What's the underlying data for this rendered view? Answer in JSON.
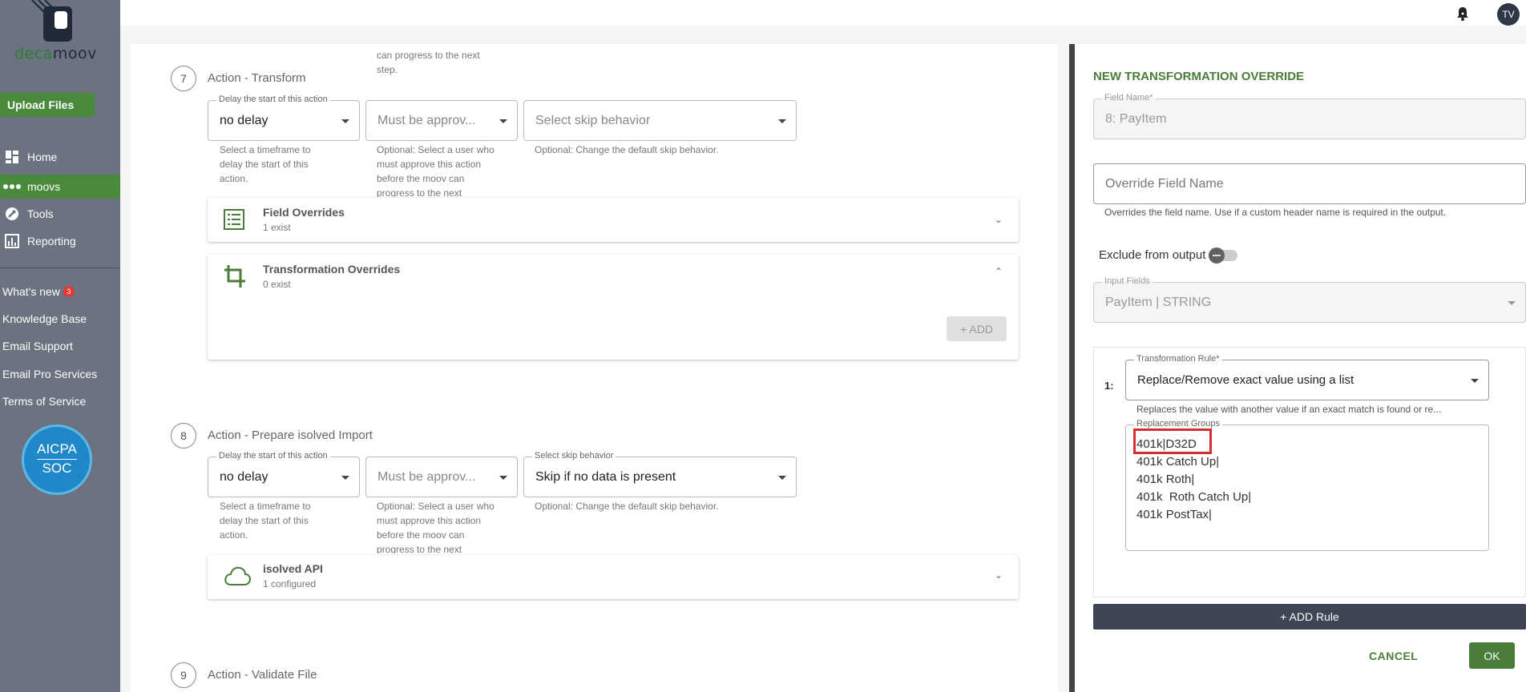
{
  "sidebar": {
    "logo_part1": "deca",
    "logo_part2": "moov",
    "upload_label": "Upload Files",
    "nav": [
      {
        "label": "Home",
        "icon": "home-grid-icon"
      },
      {
        "label": "moovs",
        "icon": "dots-icon",
        "active": true
      },
      {
        "label": "Tools",
        "icon": "wrench-icon"
      },
      {
        "label": "Reporting",
        "icon": "bar-chart-icon"
      }
    ],
    "links": [
      {
        "label": "What's new",
        "badge": "3"
      },
      {
        "label": "Knowledge Base"
      },
      {
        "label": "Email Support"
      },
      {
        "label": "Email Pro Services"
      },
      {
        "label": "Terms of Service"
      }
    ],
    "aicpa": {
      "line1": "AICPA",
      "line2": "SOC"
    }
  },
  "topbar": {
    "avatar_initials": "TV",
    "accent": "#4a8a3c"
  },
  "main": {
    "top_overflow_help": "can progress to the next step.",
    "steps": [
      {
        "number": "7",
        "title": "Action - Transform",
        "delay_label": "Delay the start of this action",
        "delay_value": "no delay",
        "delay_help": "Select a timeframe to delay the start of this action.",
        "approver_placeholder": "Must be approv...",
        "approver_help": "Optional: Select a user who must approve this action before the moov can progress to the next",
        "skip_placeholder": "Select skip behavior",
        "skip_help": "Optional: Change the default skip behavior.",
        "cards": [
          {
            "title": "Field Overrides",
            "sub": "1 exist",
            "icon": "list-icon"
          },
          {
            "title": "Transformation Overrides",
            "sub": "0 exist",
            "icon": "crop-icon",
            "add_label": "+ ADD"
          }
        ]
      },
      {
        "number": "8",
        "title": "Action - Prepare isolved Import",
        "delay_label": "Delay the start of this action",
        "delay_value": "no delay",
        "delay_help": "Select a timeframe to delay the start of this action.",
        "approver_placeholder": "Must be approv...",
        "approver_help": "Optional: Select a user who must approve this action before the moov can progress to the next",
        "skip_label": "Select skip behavior",
        "skip_value": "Skip if no data is present",
        "skip_help": "Optional: Change the default skip behavior.",
        "cards": [
          {
            "title": "isolved API",
            "sub": "1 configured",
            "icon": "cloud-icon"
          }
        ]
      },
      {
        "number": "9",
        "title": "Action - Validate File"
      }
    ]
  },
  "panel": {
    "title": "NEW TRANSFORMATION OVERRIDE",
    "field_name_label": "Field Name*",
    "field_name_value": "8: PayItem",
    "override_placeholder": "Override Field Name",
    "override_help": "Overrides the field name. Use if a custom header name is required in the output.",
    "exclude_label": "Exclude from output",
    "input_fields_label": "Input Fields",
    "input_fields_value": "PayItem | STRING",
    "rule_number": "1:",
    "rule_label": "Transformation Rule*",
    "rule_value": "Replace/Remove exact value using a list",
    "rule_help": "Replaces the value with another value if an exact match is found or re...",
    "groups_label": "Replacement Groups",
    "groups_value": "401k|D32D\n401k Catch Up|\n401k Roth|\n401k  Roth Catch Up|\n401k PostTax|",
    "add_rule_label": "+ ADD Rule",
    "cancel_label": "CANCEL",
    "ok_label": "OK"
  }
}
